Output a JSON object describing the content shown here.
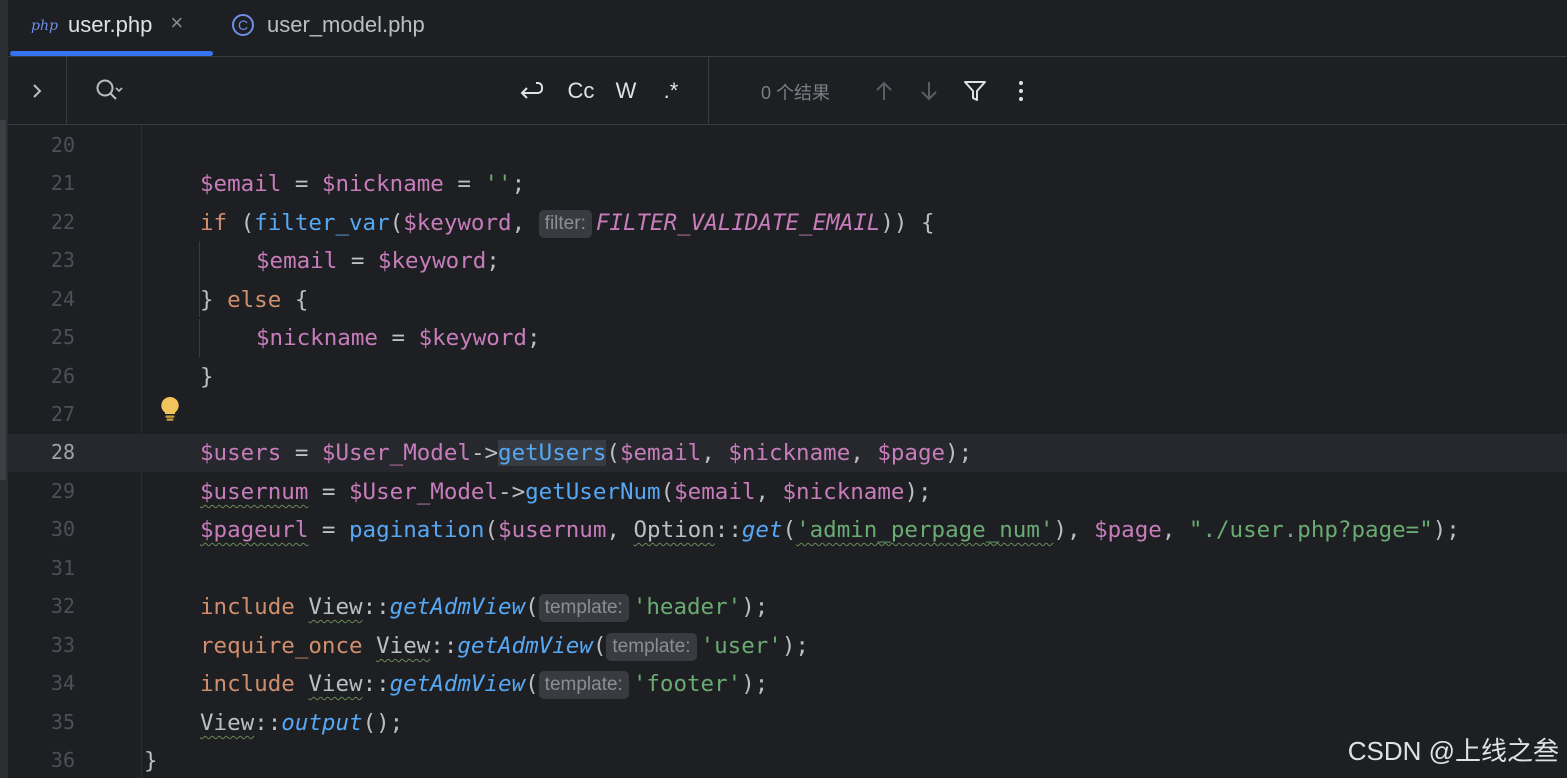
{
  "tabs": [
    {
      "badge": "php",
      "label": "user.php",
      "close": "×",
      "active": true
    },
    {
      "badge": "C",
      "label": "user_model.php",
      "active": false
    }
  ],
  "find": {
    "query": "",
    "options": {
      "newline": "↵",
      "match_case": "Cc",
      "words": "W",
      "regex": ".*"
    },
    "result_text": "0 个结果",
    "icons": {
      "expand": "chevron-right-icon",
      "search": "search-history-icon",
      "prev": "arrow-up-icon",
      "next": "arrow-down-icon",
      "filter": "filter-icon",
      "more": "more-vertical-icon"
    }
  },
  "editor": {
    "current_line": 28,
    "lines": [
      {
        "n": "20"
      },
      {
        "n": "21"
      },
      {
        "n": "22"
      },
      {
        "n": "23"
      },
      {
        "n": "24"
      },
      {
        "n": "25"
      },
      {
        "n": "26"
      },
      {
        "n": "27"
      },
      {
        "n": "28"
      },
      {
        "n": "29"
      },
      {
        "n": "30"
      },
      {
        "n": "31"
      },
      {
        "n": "32"
      },
      {
        "n": "33"
      },
      {
        "n": "34"
      },
      {
        "n": "35"
      },
      {
        "n": "36"
      }
    ],
    "code": {
      "l21": {
        "t1": "$email",
        "t2": " = ",
        "t3": "$nickname",
        "t4": " = ",
        "t5": "''",
        "t6": ";"
      },
      "l22": {
        "t1": "if",
        "t2": " (",
        "t3": "filter_var",
        "t4": "(",
        "t5": "$keyword",
        "t6": ", ",
        "hint": "filter:",
        "t7": "FILTER_VALIDATE_EMAIL",
        "t8": ")) {"
      },
      "l23": {
        "t1": "$email",
        "t2": " = ",
        "t3": "$keyword",
        "t4": ";"
      },
      "l24": {
        "t1": "} ",
        "t2": "else",
        "t3": " {"
      },
      "l25": {
        "t1": "$nickname",
        "t2": " = ",
        "t3": "$keyword",
        "t4": ";"
      },
      "l26": {
        "t1": "}"
      },
      "l28": {
        "t1": "$users",
        "t2": " = ",
        "t3": "$User_Model",
        "t4": "->",
        "t5": "getUsers",
        "t6": "(",
        "t7": "$email",
        "t8": ", ",
        "t9": "$nickname",
        "t10": ", ",
        "t11": "$page",
        "t12": ");"
      },
      "l29": {
        "t1": "$usernum",
        "t2": " = ",
        "t3": "$User_Model",
        "t4": "->",
        "t5": "getUserNum",
        "t6": "(",
        "t7": "$email",
        "t8": ", ",
        "t9": "$nickname",
        "t10": ");"
      },
      "l30": {
        "t1": "$pageurl",
        "t2": " = ",
        "t3": "pagination",
        "t4": "(",
        "t5": "$usernum",
        "t6": ", ",
        "t7": "Option",
        "t8": "::",
        "t9": "get",
        "t10": "(",
        "t11": "'admin_perpage_num'",
        "t12": "), ",
        "t13": "$page",
        "t14": ", ",
        "t15": "\"./user.php?page=\"",
        "t16": ");"
      },
      "l32": {
        "t1": "include",
        "t2": " ",
        "t3": "View",
        "t4": "::",
        "t5": "getAdmView",
        "t6": "(",
        "hint": "template:",
        "t7": "'header'",
        "t8": ");"
      },
      "l33": {
        "t1": "require_once",
        "t2": " ",
        "t3": "View",
        "t4": "::",
        "t5": "getAdmView",
        "t6": "(",
        "hint": "template:",
        "t7": "'user'",
        "t8": ");"
      },
      "l34": {
        "t1": "include",
        "t2": " ",
        "t3": "View",
        "t4": "::",
        "t5": "getAdmView",
        "t6": "(",
        "hint": "template:",
        "t7": "'footer'",
        "t8": ");"
      },
      "l35": {
        "t1": "View",
        "t2": "::",
        "t3": "output",
        "t4": "();"
      },
      "l36": {
        "t1": "}"
      }
    },
    "intention_icon": "lightbulb-icon"
  },
  "watermark": "CSDN @上线之叁",
  "colors": {
    "background": "#1e1f22",
    "accent": "#3574f0",
    "variable": "#c77dbb",
    "keyword": "#cf8e6d",
    "function": "#56a8f5",
    "string": "#6aab73"
  }
}
